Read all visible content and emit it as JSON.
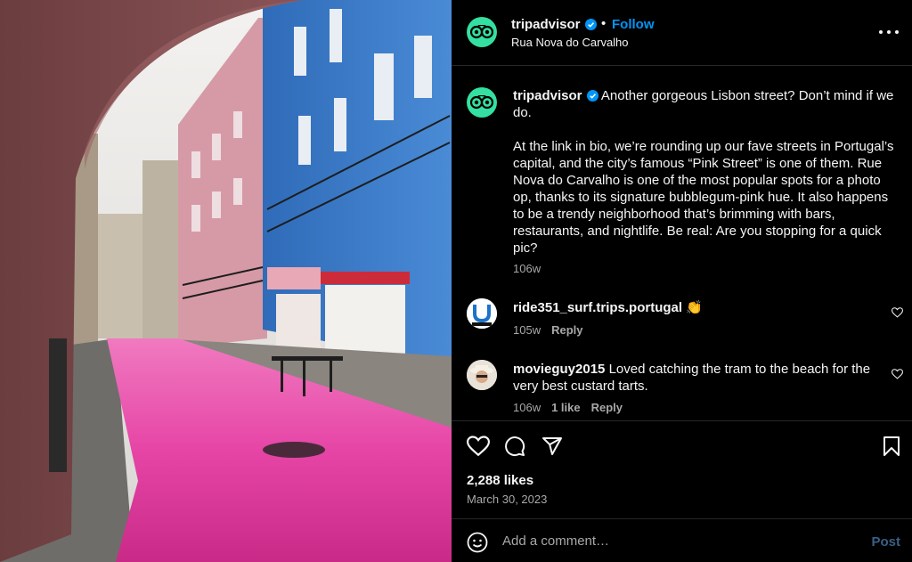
{
  "photo": {
    "description_icon": "photo-image"
  },
  "header": {
    "username": "tripadvisor",
    "separator": "•",
    "follow_label": "Follow",
    "location": "Rua Nova do Carvalho"
  },
  "caption": {
    "username": "tripadvisor",
    "line1": "Another gorgeous Lisbon street? Don’t mind if we do.",
    "line2": "At the link in bio, we’re rounding up our fave streets in Portugal’s capital, and the city’s famous “Pink Street” is one of them. Rue Nova do Carvalho is one of the most popular spots for a photo op, thanks to its signature bubblegum-pink hue. It also happens to be a trendy neighborhood that’s brimming with bars, restaurants, and nightlife. Be real: Are you stopping for a quick pic?",
    "time": "106w"
  },
  "comments": [
    {
      "username": "ride351_surf.trips.portugal",
      "text": "👏",
      "time": "105w",
      "likes": "",
      "reply": "Reply"
    },
    {
      "username": "movieguy2015",
      "text": "Loved catching the tram to the beach for the very best custard tarts.",
      "time": "106w",
      "likes": "1 like",
      "reply": "Reply"
    }
  ],
  "actions": {
    "likes": "2,288 likes",
    "date": "March 30, 2023"
  },
  "add_comment": {
    "placeholder": "Add a comment…",
    "post_label": "Post"
  },
  "colors": {
    "accent": "#0095f6",
    "brand_green": "#34e0a1",
    "pink_street": "#e0409e"
  }
}
